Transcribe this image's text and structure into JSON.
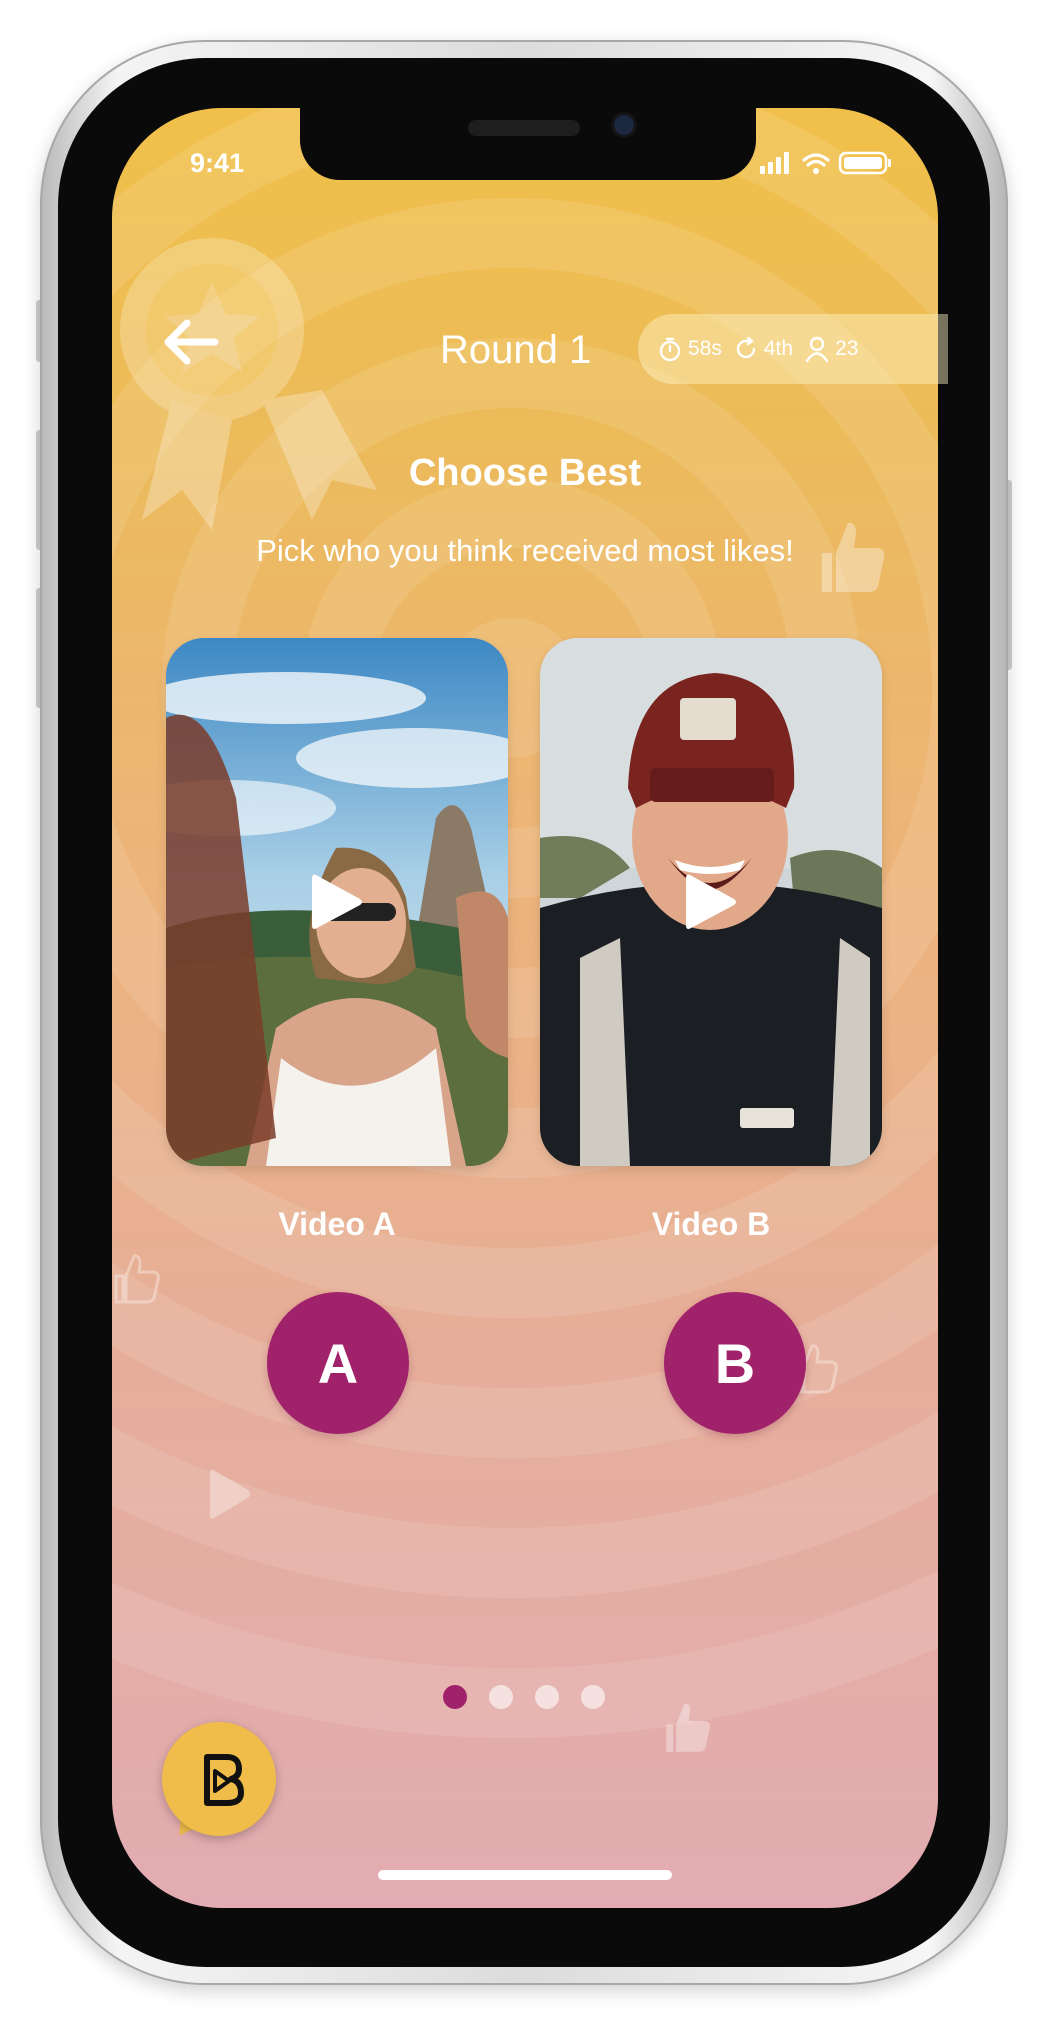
{
  "status_bar": {
    "time": "9:41"
  },
  "header": {
    "round_title": "Round 1",
    "stats": {
      "timer": "58s",
      "rank": "4th",
      "players": "23"
    }
  },
  "prompt": {
    "title": "Choose Best",
    "subtitle": "Pick who you think received most likes!"
  },
  "videos": [
    {
      "label": "Video A",
      "choice": "A"
    },
    {
      "label": "Video B",
      "choice": "B"
    }
  ],
  "pagination": {
    "total": 4,
    "active_index": 0
  },
  "colors": {
    "accent": "#a0226a",
    "gradient_top": "#f0c04a",
    "gradient_bottom": "#e2acb2",
    "chat_fab": "#f0bd4a"
  },
  "icons": {
    "back": "arrow-left-icon",
    "timer": "stopwatch-icon",
    "rank": "refresh-icon",
    "players": "person-icon",
    "play": "play-icon",
    "chat": "chat-logo-icon"
  }
}
